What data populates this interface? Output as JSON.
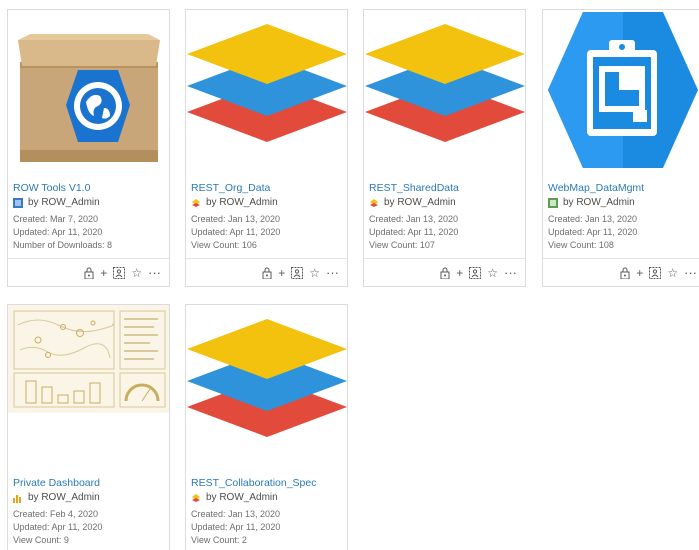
{
  "cards": [
    {
      "title": "ROW Tools V1.0",
      "owner": "by ROW_Admin",
      "meta": [
        "Created: Mar 7, 2020",
        "Updated: Apr 11, 2020",
        "Number of Downloads: 8"
      ],
      "thumb": "package-icon",
      "type_icon": "toolbox-icon"
    },
    {
      "title": "REST_Org_Data",
      "owner": "by ROW_Admin",
      "meta": [
        "Created: Jan 13, 2020",
        "Updated: Apr 11, 2020",
        "View Count: 106"
      ],
      "thumb": "layers-icon",
      "type_icon": "feature-layer-icon"
    },
    {
      "title": "REST_SharedData",
      "owner": "by ROW_Admin",
      "meta": [
        "Created: Jan 13, 2020",
        "Updated: Apr 11, 2020",
        "View Count: 107"
      ],
      "thumb": "layers-icon",
      "type_icon": "feature-layer-icon"
    },
    {
      "title": "WebMap_DataMgmt",
      "owner": "by ROW_Admin",
      "meta": [
        "Created: Jan 13, 2020",
        "Updated: Apr 11, 2020",
        "View Count: 108"
      ],
      "thumb": "clipboard-map-icon",
      "type_icon": "web-map-icon"
    },
    {
      "title": "Private Dashboard",
      "owner": "by ROW_Admin",
      "meta": [
        "Created: Feb 4, 2020",
        "Updated: Apr 11, 2020",
        "View Count: 9"
      ],
      "thumb": "dashboard-icon",
      "type_icon": "dashboard-type-icon"
    },
    {
      "title": "REST_Collaboration_Spec",
      "owner": "by ROW_Admin",
      "meta": [
        "Created: Jan 13, 2020",
        "Updated: Apr 11, 2020",
        "View Count: 2"
      ],
      "thumb": "layers-icon",
      "type_icon": "feature-layer-icon"
    }
  ],
  "footer_icons": [
    "share-lock-icon",
    "add-icon",
    "add-to-group-icon",
    "favorite-star-icon",
    "more-options-icon"
  ],
  "colors": {
    "title_link": "#2a7ab6",
    "layer_yellow": "#f2c20f",
    "layer_blue": "#2e93db",
    "layer_red": "#e24b3c",
    "box_brown": "#c9a57a",
    "webmap_blue": "#1a8be0"
  }
}
